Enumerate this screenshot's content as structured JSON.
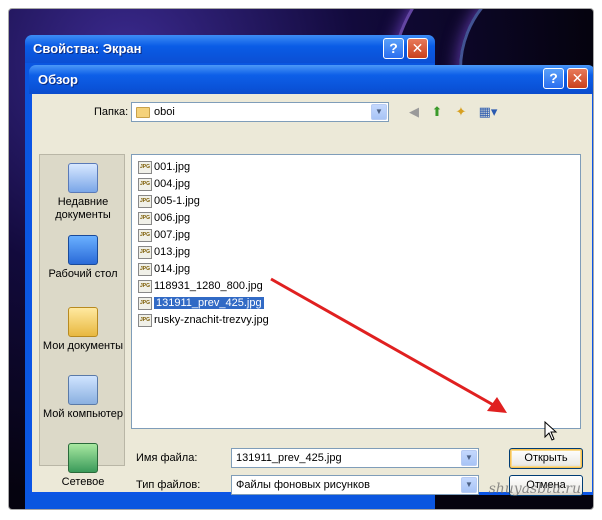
{
  "background_dialog": {
    "title": "Свойства: Экран"
  },
  "dialog": {
    "title": "Обзор",
    "folder_label": "Папка:",
    "folder_value": "oboi",
    "places": [
      {
        "label": "Недавние документы",
        "icon": "recent-documents-icon"
      },
      {
        "label": "Рабочий стол",
        "icon": "desktop-icon"
      },
      {
        "label": "Мои документы",
        "icon": "my-documents-icon"
      },
      {
        "label": "Мой компьютер",
        "icon": "my-computer-icon"
      },
      {
        "label": "Сетевое",
        "icon": "network-icon"
      }
    ],
    "files": [
      "001.jpg",
      "004.jpg",
      "005-1.jpg",
      "006.jpg",
      "007.jpg",
      "013.jpg",
      "014.jpg",
      "118931_1280_800.jpg",
      "131911_prev_425.jpg",
      "rusky-znachit-trezvy.jpg"
    ],
    "selected_file": "131911_prev_425.jpg",
    "filename_label": "Имя файла:",
    "filename_value": "131911_prev_425.jpg",
    "filetype_label": "Тип файлов:",
    "filetype_value": "Файлы фоновых рисунков",
    "open_button": "Открыть",
    "cancel_button": "Отмена",
    "help_button": "?",
    "close_button": "✕"
  },
  "watermark": "shuyasbtu.ru",
  "colors": {
    "title_bar": "#0a5ce6",
    "selection": "#316ac5",
    "annotation_arrow": "#e02020"
  }
}
